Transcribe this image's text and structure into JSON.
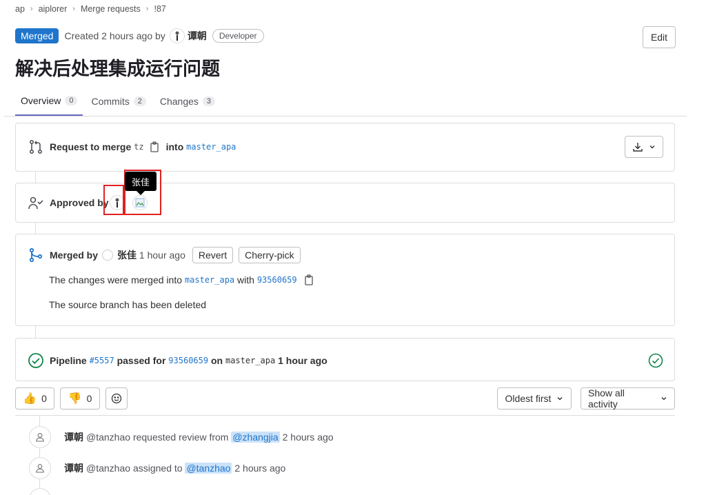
{
  "breadcrumb": [
    "ap",
    "aiplorer",
    "Merge requests",
    "!87"
  ],
  "header": {
    "status": "Merged",
    "created_text": "Created",
    "created_time": "2 hours ago",
    "by_text": "by",
    "author": "谭朝",
    "role": "Developer",
    "edit_label": "Edit"
  },
  "title": "解决后处理集成运行问题",
  "tabs": [
    {
      "label": "Overview",
      "count": "0"
    },
    {
      "label": "Commits",
      "count": "2"
    },
    {
      "label": "Changes",
      "count": "3"
    }
  ],
  "merge_info": {
    "request_label": "Request to merge",
    "source_branch": "tz",
    "into_label": "into",
    "target_branch": "master_apa"
  },
  "approval": {
    "label": "Approved by",
    "tooltip": "张佳"
  },
  "merged": {
    "label": "Merged by",
    "user": "张佳",
    "time": "1 hour ago",
    "revert_label": "Revert",
    "cherry_label": "Cherry-pick",
    "changes_prefix": "The changes were merged into",
    "target_branch": "master_apa",
    "with_text": "with",
    "commit": "93560659",
    "source_deleted": "The source branch has been deleted"
  },
  "pipeline": {
    "label": "Pipeline",
    "id": "#5557",
    "passed_for": "passed for",
    "commit": "93560659",
    "on_text": "on",
    "branch": "master_apa",
    "time": "1 hour ago"
  },
  "reactions": {
    "thumbs_up": "0",
    "thumbs_down": "0"
  },
  "sort": {
    "order_label": "Oldest first",
    "filter_label": "Show all activity"
  },
  "activity": [
    {
      "name": "谭朝",
      "handle": "@tanzhao",
      "action": "requested review from",
      "mention": "@zhangjia",
      "time": "2 hours ago"
    },
    {
      "name": "谭朝",
      "handle": "@tanzhao",
      "action": "assigned to",
      "mention": "@tanzhao",
      "time": "2 hours ago"
    }
  ],
  "colors": {
    "brand_blue": "#1f75cb",
    "success_green": "#108548",
    "annotation_red": "#e02020",
    "tab_underline": "#6666c4"
  }
}
